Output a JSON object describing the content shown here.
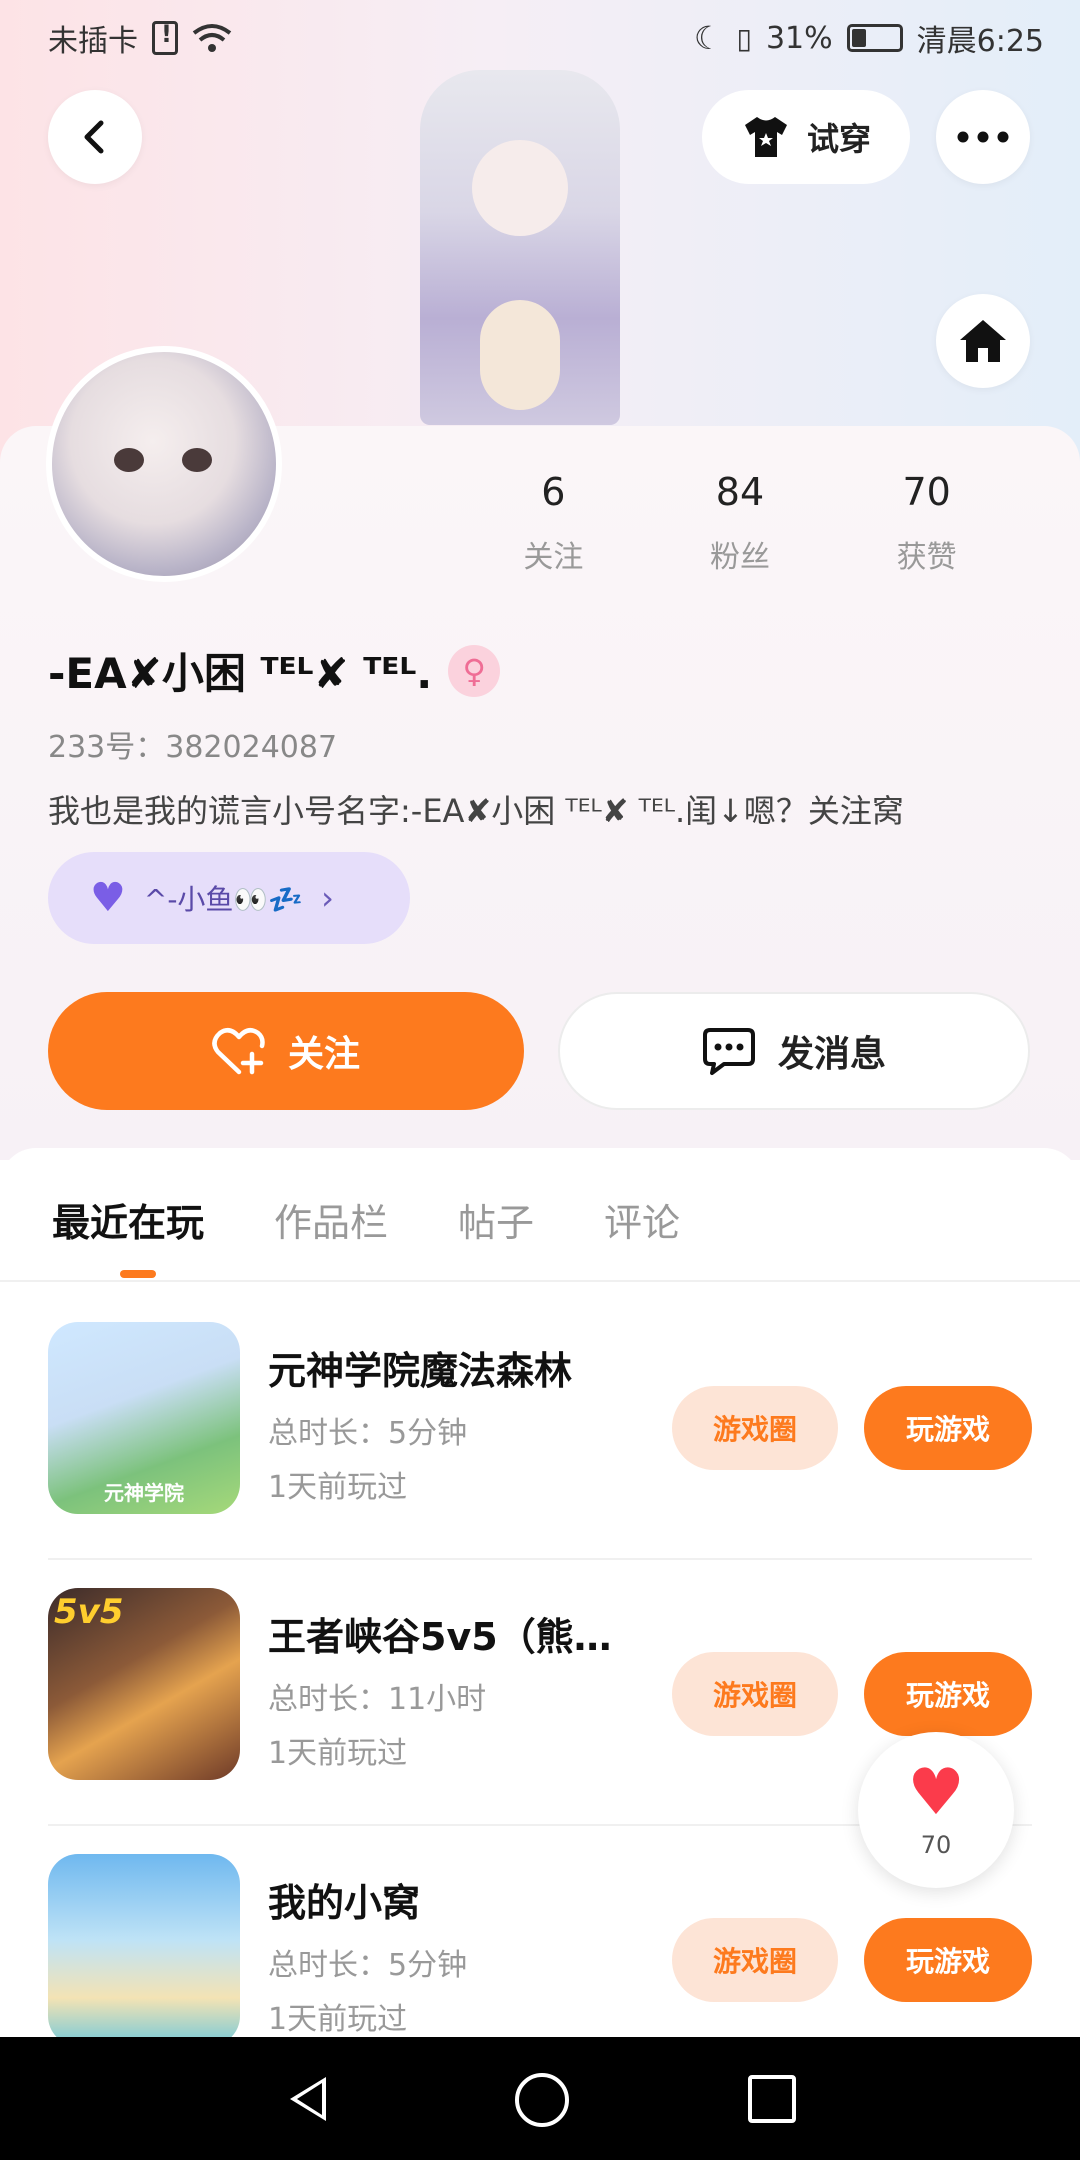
{
  "status_bar": {
    "carrier": "未插卡",
    "battery": "31%",
    "battery_level": 0.31,
    "time": "清晨6:25"
  },
  "header": {
    "try_on_label": "试穿"
  },
  "profile": {
    "stats": [
      {
        "value": "6",
        "label": "关注"
      },
      {
        "value": "84",
        "label": "粉丝"
      },
      {
        "value": "70",
        "label": "获赞"
      }
    ],
    "nickname": "-EA✘小困 ᵀᴱᴸ✘ ᵀᴱᴸ.",
    "gender_symbol": "♀",
    "uid": "233号：382024087",
    "bio": "我也是我的谎言小号名字:-EA✘小困 ᵀᴱᴸ✘ ᵀᴱᴸ.闺↓嗯？关注窝",
    "tag_chip": "^-小鱼👀💤",
    "follow_label": "关注",
    "message_label": "发消息"
  },
  "tabs": [
    {
      "label": "最近在玩",
      "active": true
    },
    {
      "label": "作品栏",
      "active": false
    },
    {
      "label": "帖子",
      "active": false
    },
    {
      "label": "评论",
      "active": false
    }
  ],
  "games": [
    {
      "title": "元神学院魔法森林",
      "duration": "总时长：5分钟",
      "last_played": "1天前玩过",
      "icon_caption": "元神学院",
      "circle_label": "游戏圈",
      "play_label": "玩游戏"
    },
    {
      "title": "王者峡谷5v5（熊…",
      "duration": "总时长：11小时",
      "last_played": "1天前玩过",
      "icon_badge": "5v5",
      "circle_label": "游戏圈",
      "play_label": "玩游戏"
    },
    {
      "title": "我的小窝",
      "duration": "总时长：5分钟",
      "last_played": "1天前玩过",
      "circle_label": "游戏圈",
      "play_label": "玩游戏"
    }
  ],
  "like_fab": {
    "count": "70"
  },
  "colors": {
    "accent": "#fd7a1e",
    "accent_light": "#fde4d6",
    "tag_bg": "#e6defa",
    "like_red": "#fb3b4b"
  },
  "icons": [
    "back-icon",
    "tshirt-icon",
    "more-icon",
    "home-icon",
    "heart-plus-icon",
    "chat-icon",
    "heart-icon",
    "nav-back-icon",
    "nav-home-icon",
    "nav-recent-icon"
  ]
}
